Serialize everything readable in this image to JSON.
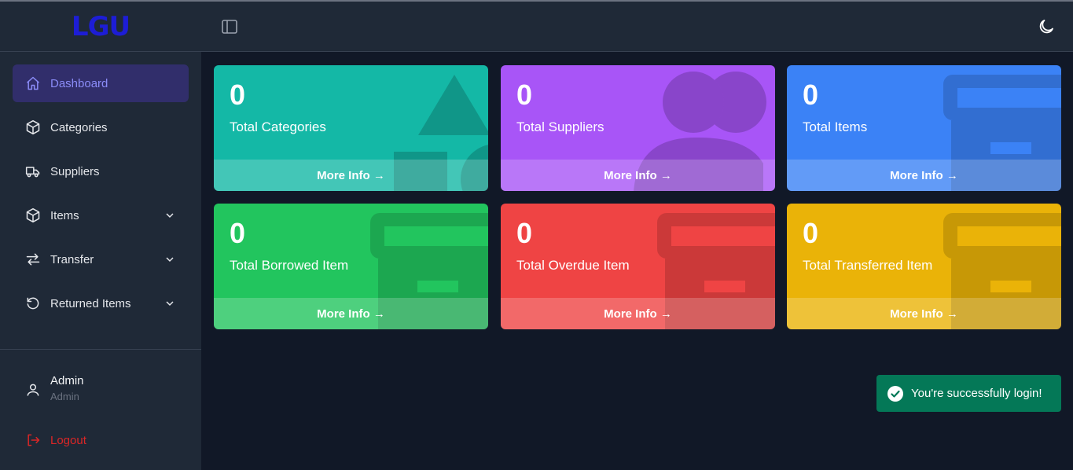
{
  "app": {
    "logo": "LGU"
  },
  "sidebar": {
    "items": [
      {
        "label": "Dashboard",
        "icon": "home-icon",
        "active": true,
        "expandable": false
      },
      {
        "label": "Categories",
        "icon": "cube-icon",
        "active": false,
        "expandable": false
      },
      {
        "label": "Suppliers",
        "icon": "truck-icon",
        "active": false,
        "expandable": false
      },
      {
        "label": "Items",
        "icon": "cube-icon",
        "active": false,
        "expandable": true
      },
      {
        "label": "Transfer",
        "icon": "arrows-right-left-icon",
        "active": false,
        "expandable": true
      },
      {
        "label": "Returned Items",
        "icon": "undo-icon",
        "active": false,
        "expandable": true
      }
    ],
    "user": {
      "name": "Admin",
      "role": "Admin"
    },
    "logout_label": "Logout"
  },
  "header": {
    "toggle_icon": "sidebar-toggle-icon",
    "theme_icon": "moon-icon"
  },
  "cards": [
    {
      "value": "0",
      "label": "Total Categories",
      "link": "More Info →",
      "color": "#14b8a6"
    },
    {
      "value": "0",
      "label": "Total Suppliers",
      "link": "More Info →",
      "color": "#a855f7"
    },
    {
      "value": "0",
      "label": "Total Items",
      "link": "More Info →",
      "color": "#3b82f6"
    },
    {
      "value": "0",
      "label": "Total Borrowed Item",
      "link": "More Info →",
      "color": "#22c55e"
    },
    {
      "value": "0",
      "label": "Total Overdue Item",
      "link": "More Info →",
      "color": "#ef4444"
    },
    {
      "value": "0",
      "label": "Total Transferred Item",
      "link": "More Info →",
      "color": "#eab308"
    }
  ],
  "toast": {
    "message": "You're successfully login!",
    "color": "#047857"
  },
  "colors": {
    "accent": "#8b8cf8",
    "sidebar_bg": "#1f2937",
    "page_bg": "#111827",
    "logo": "#1d1dd6",
    "danger": "#dc2626"
  }
}
